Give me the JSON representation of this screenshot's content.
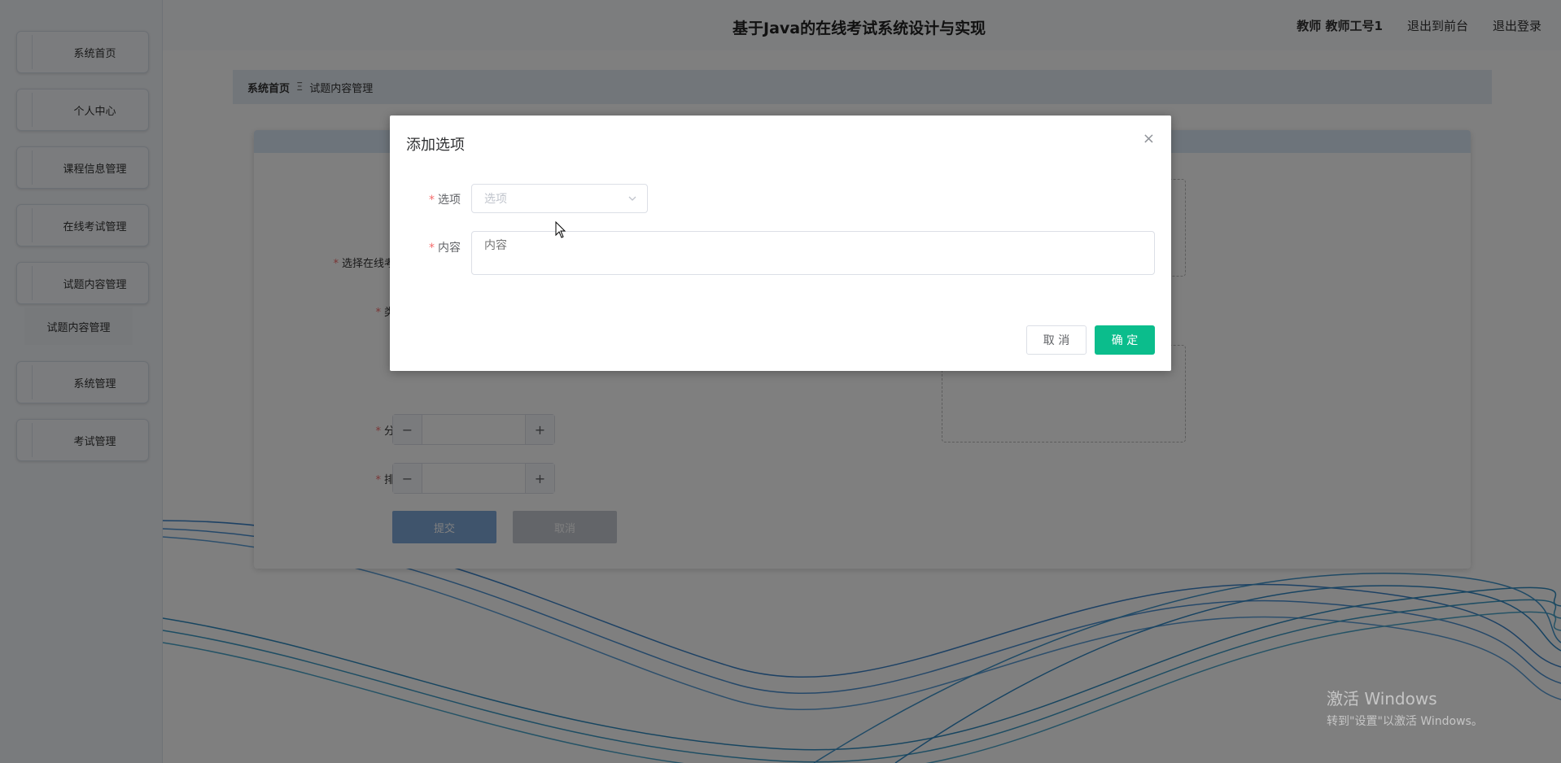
{
  "header": {
    "site_title": "基于Java的在线考试系统设计与实现",
    "user": "教师 教师工号1",
    "to_front": "退出到前台",
    "logout": "退出登录"
  },
  "sidebar": {
    "items": [
      {
        "label": "系统首页"
      },
      {
        "label": "个人中心"
      },
      {
        "label": "课程信息管理"
      },
      {
        "label": "在线考试管理"
      },
      {
        "label": "试题内容管理"
      },
      {
        "label": "系统管理"
      },
      {
        "label": "考试管理"
      }
    ],
    "sub_items": [
      {
        "label": "试题内容管理"
      }
    ]
  },
  "breadcrumb": {
    "home": "系统首页",
    "separator": "Ξ",
    "current": "试题内容管理"
  },
  "form": {
    "exam_label": "选择在线考试",
    "type_label": "类型",
    "score_label": "分数",
    "order_label": "排序",
    "submit": "提交",
    "cancel": "取消",
    "minus": "−",
    "plus": "+"
  },
  "dialog": {
    "title": "添加选项",
    "close": "×",
    "option_label": "选项",
    "option_placeholder": "选项",
    "content_label": "内容",
    "content_placeholder": "内容",
    "cancel": "取 消",
    "confirm": "确 定"
  },
  "watermark": {
    "line1": "激活 Windows",
    "line2": "转到\"设置\"以激活 Windows。"
  },
  "colors": {
    "primary": "#0bbd8c",
    "required": "#f56c6c",
    "submit_button": "#7ea9d8"
  }
}
